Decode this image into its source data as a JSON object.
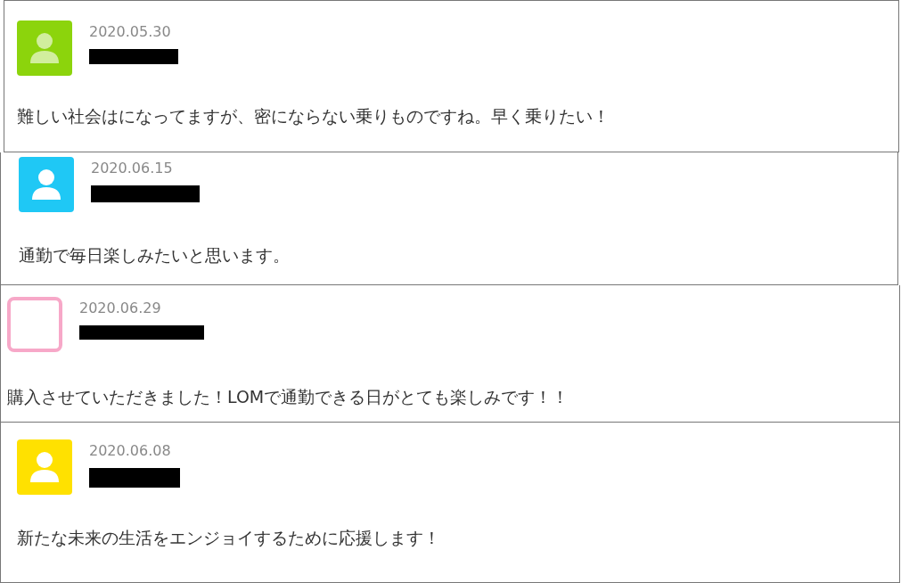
{
  "comments": [
    {
      "date": "2020.05.30",
      "avatar": {
        "kind": "person",
        "color": "#8cd40c"
      },
      "text": "難しい社会はになってますが、密にならない乗りものですね。早く乗りたい！"
    },
    {
      "date": "2020.06.15",
      "avatar": {
        "kind": "person",
        "color": "#1fc8f5"
      },
      "text": "通勤で毎日楽しみたいと思います。"
    },
    {
      "date": "2020.06.29",
      "avatar": {
        "kind": "blank",
        "color": "#f7a8c8"
      },
      "text": "購入させていただきました！LOMで通勤できる日がとても楽しみです！！"
    },
    {
      "date": "2020.06.08",
      "avatar": {
        "kind": "person",
        "color": "#ffe100"
      },
      "text": "新たな未来の生活をエンジョイするために応援します！"
    }
  ]
}
